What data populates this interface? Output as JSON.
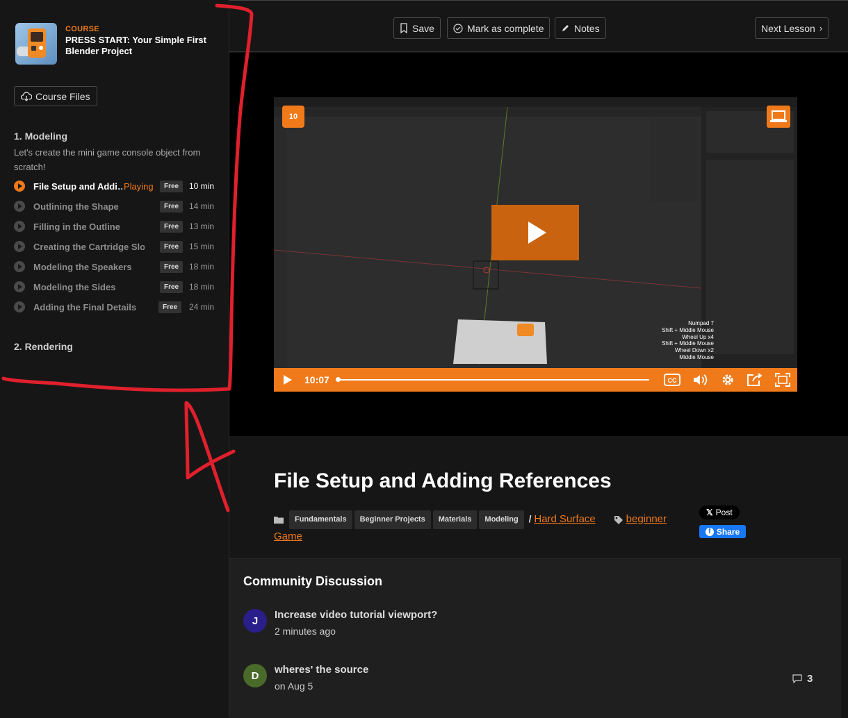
{
  "course": {
    "label": "COURSE",
    "title": "PRESS START: Your Simple First Blender Project",
    "files_button": "Course Files"
  },
  "sections": [
    {
      "title": "1. Modeling",
      "description": "Let's create the mini game console object from scratch!",
      "lessons": [
        {
          "name": "File Setup and Addi…",
          "status": "Playing",
          "badge": "Free",
          "duration": "10 min"
        },
        {
          "name": "Outlining the Shape",
          "badge": "Free",
          "duration": "14 min"
        },
        {
          "name": "Filling in the Outline",
          "badge": "Free",
          "duration": "13 min"
        },
        {
          "name": "Creating the Cartridge Slot",
          "badge": "Free",
          "duration": "15 min"
        },
        {
          "name": "Modeling the Speakers",
          "badge": "Free",
          "duration": "18 min"
        },
        {
          "name": "Modeling the Sides",
          "badge": "Free",
          "duration": "18 min"
        },
        {
          "name": "Adding the Final Details",
          "badge": "Free",
          "duration": "24 min"
        }
      ]
    },
    {
      "title": "2. Rendering"
    }
  ],
  "toolbar": {
    "save": "Save",
    "mark_complete": "Mark as complete",
    "notes": "Notes",
    "next": "Next Lesson"
  },
  "video": {
    "time": "10:07",
    "rewind_seconds": "10",
    "progress": 0.0,
    "keystrokes": [
      "Numpad 7",
      "Shift + Middle Mouse",
      "Wheel Up x4",
      "Shift + Middle Mouse",
      "Wheel Down x2",
      "Middle Mouse"
    ],
    "accent_color": "#f07a1a"
  },
  "lesson": {
    "title": "File Setup and Adding References",
    "categories": [
      "Fundamentals",
      "Beginner Projects",
      "Materials",
      "Modeling"
    ],
    "category_link": "Hard Surface",
    "tags": [
      "beginner",
      "Game"
    ]
  },
  "share": {
    "x_post": "Post",
    "fb_share": "Share"
  },
  "discussion": {
    "title": "Community Discussion",
    "posts": [
      {
        "initial": "J",
        "title": "Increase video tutorial viewport?",
        "time": "2 minutes ago",
        "color": "#2a1f8a"
      },
      {
        "initial": "D",
        "title": "wheres' the source",
        "time": "on Aug 5",
        "color": "#4a6a2a",
        "replies": "3"
      }
    ]
  }
}
